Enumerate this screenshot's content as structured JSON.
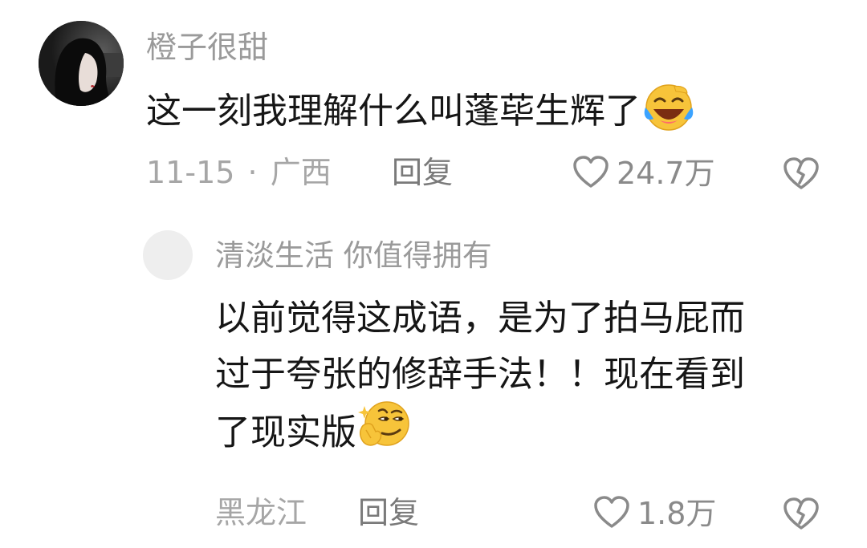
{
  "comments": [
    {
      "username": "橙子很甜",
      "text": "这一刻我理解什么叫蓬荜生辉了",
      "emoji": "crying-laughing-emoji",
      "date": "11-15",
      "separator": "·",
      "location": "广西",
      "reply_label": "回复",
      "likes": "24.7万"
    }
  ],
  "replies": [
    {
      "username": "清淡生活 你值得拥有",
      "lines": [
        "以前觉得这成语，是为了拍马屁而",
        "过于夸张的修辞手法！！现在看到",
        "了现实版"
      ],
      "emoji": "thinking-smirk-emoji",
      "location": "黑龙江",
      "reply_label": "回复",
      "likes": "1.8万"
    }
  ],
  "colors": {
    "username": "#9a9a9a",
    "body_text": "#161616",
    "meta_text": "#a6a6a6",
    "emoji_yellow": "#f7c43a"
  }
}
